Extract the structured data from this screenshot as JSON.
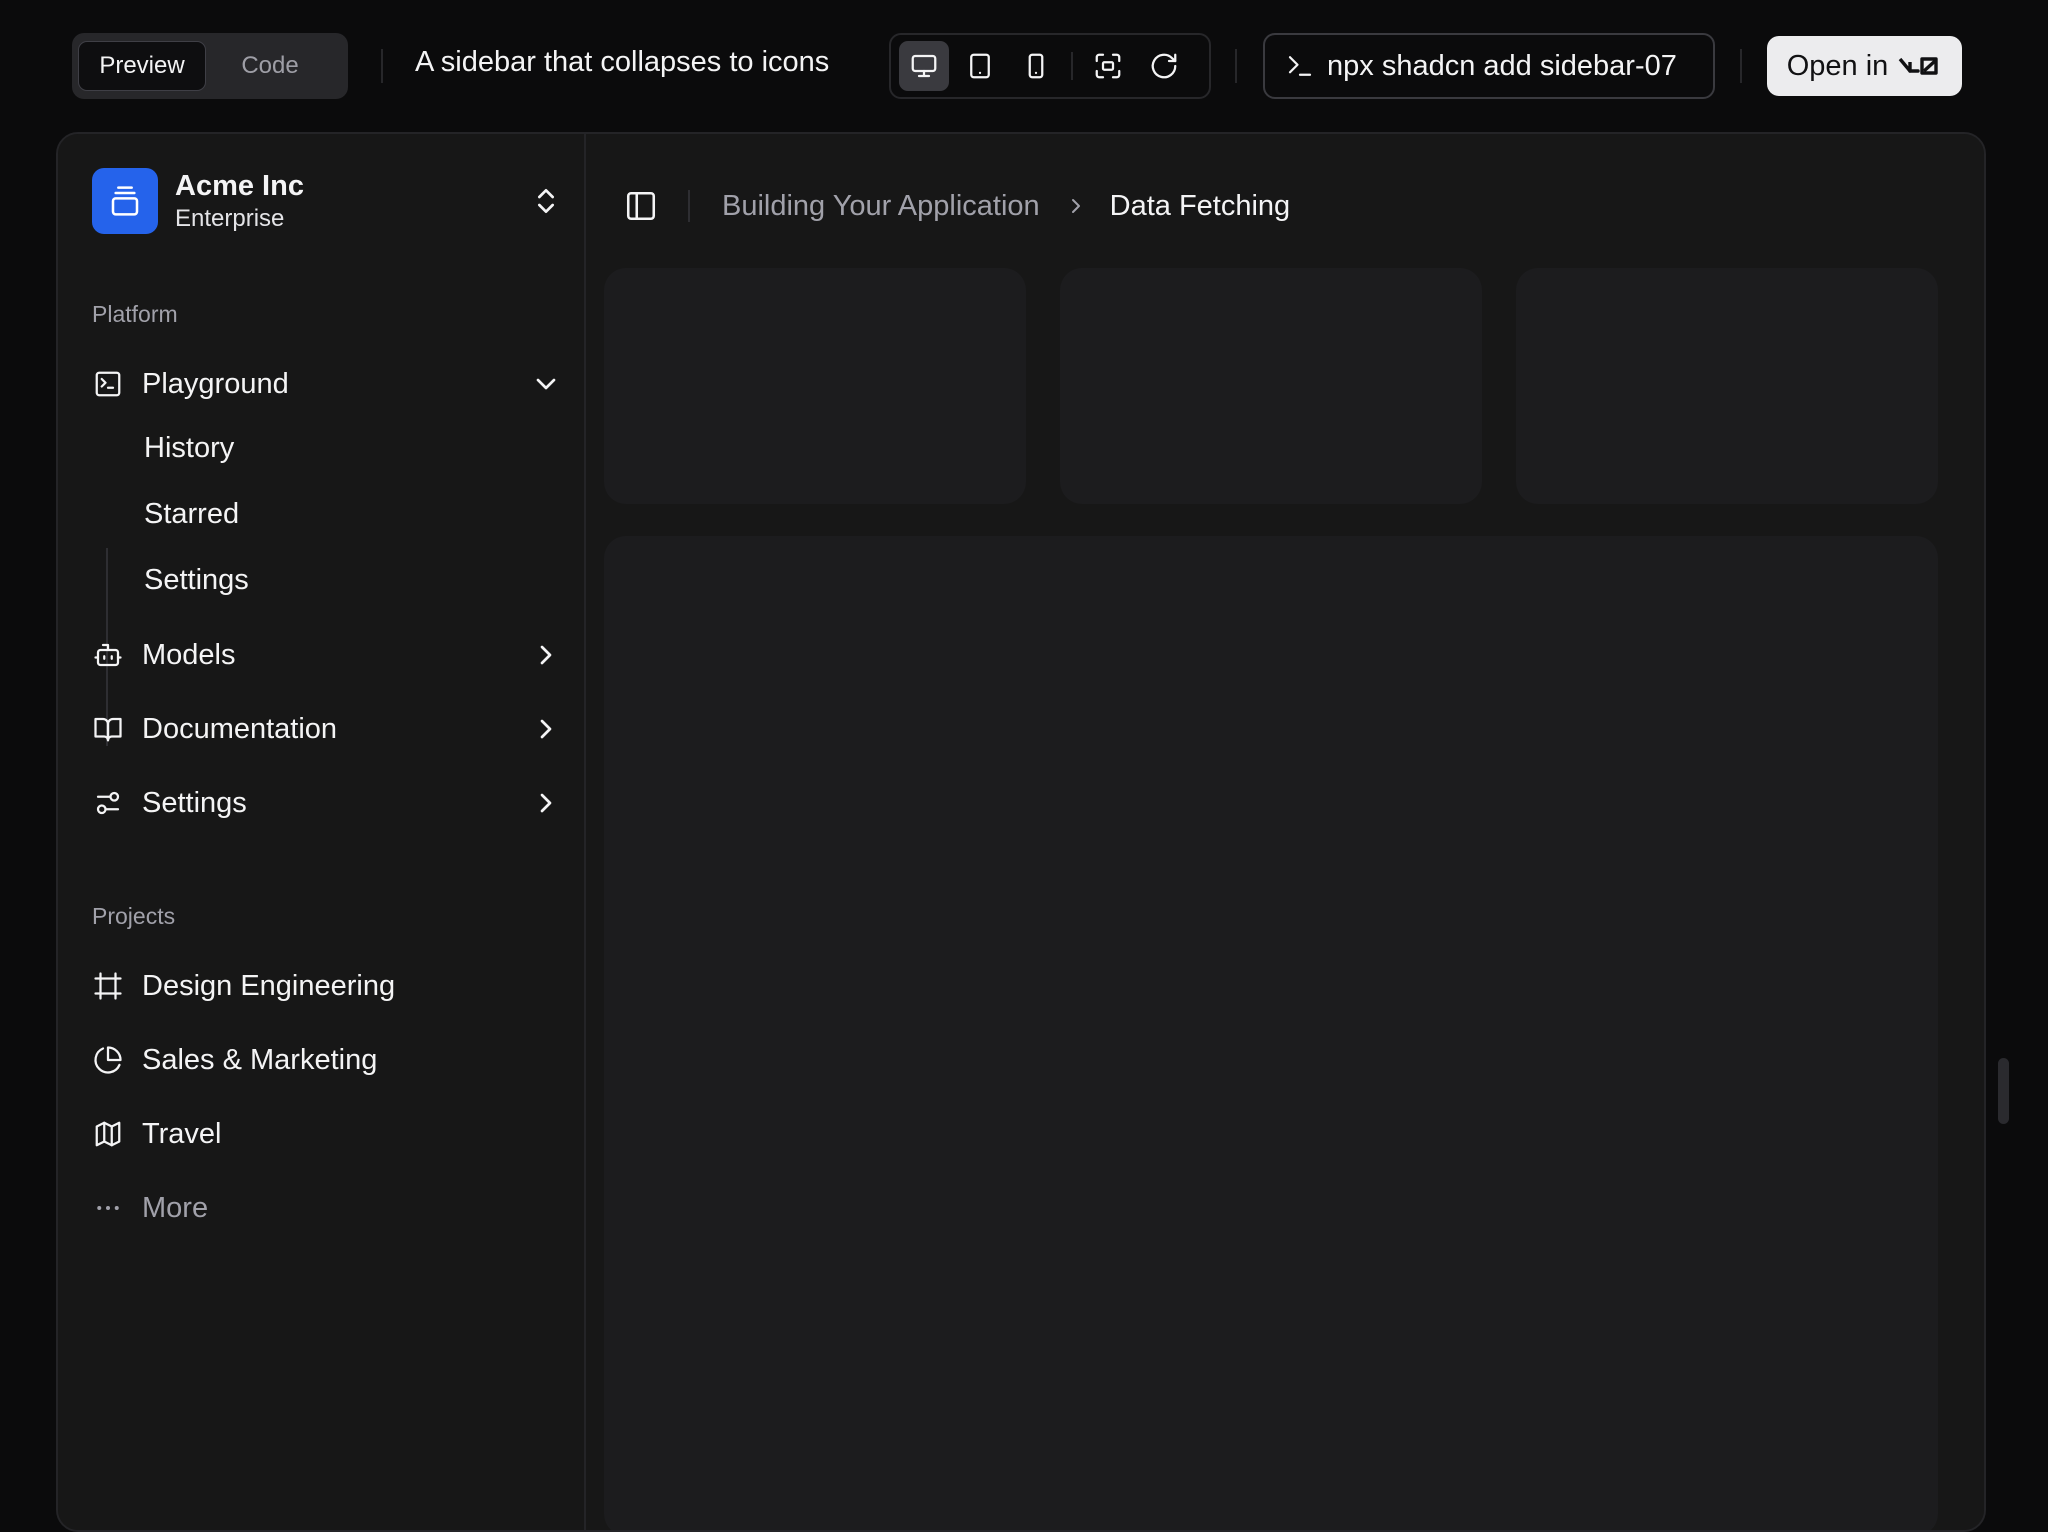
{
  "toolbar": {
    "tabs": [
      {
        "label": "Preview",
        "active": true
      },
      {
        "label": "Code",
        "active": false
      }
    ],
    "description": "A sidebar that collapses to icons",
    "view_buttons": [
      "desktop-icon",
      "tablet-icon",
      "phone-icon",
      "fullscreen-icon",
      "refresh-icon"
    ],
    "command": "npx shadcn add sidebar-07",
    "open_label": "Open in"
  },
  "sidebar": {
    "team": {
      "name": "Acme Inc",
      "plan": "Enterprise"
    },
    "platform_label": "Platform",
    "platform_items": [
      {
        "label": "Playground",
        "icon": "terminal-square-icon",
        "expanded": true
      },
      {
        "label": "Models",
        "icon": "bot-icon",
        "expanded": false
      },
      {
        "label": "Documentation",
        "icon": "book-open-icon",
        "expanded": false
      },
      {
        "label": "Settings",
        "icon": "settings-sliders-icon",
        "expanded": false
      }
    ],
    "playground_sub": [
      "History",
      "Starred",
      "Settings"
    ],
    "projects_label": "Projects",
    "projects": [
      {
        "label": "Design Engineering",
        "icon": "frame-icon"
      },
      {
        "label": "Sales & Marketing",
        "icon": "pie-chart-icon"
      },
      {
        "label": "Travel",
        "icon": "map-icon"
      }
    ],
    "more_label": "More"
  },
  "breadcrumb": {
    "parent": "Building Your Application",
    "current": "Data Fetching"
  },
  "colors": {
    "accent": "#2563eb",
    "background": "#0b0b0c",
    "panel": "#171717",
    "card": "#1c1c1e"
  }
}
